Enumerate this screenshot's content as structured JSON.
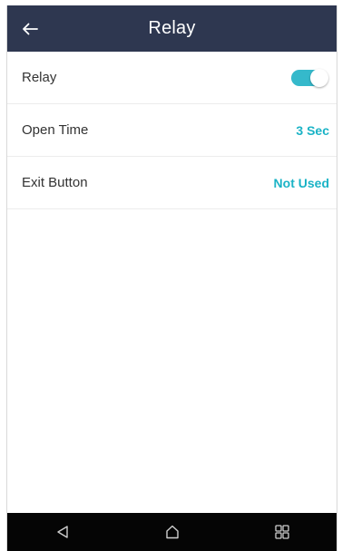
{
  "app_bar": {
    "title": "Relay",
    "background": "#2e3750",
    "back_icon": "arrow-left-icon"
  },
  "settings": [
    {
      "label": "Relay",
      "type": "toggle",
      "enabled": true
    },
    {
      "label": "Open Time",
      "type": "value",
      "value": "3 Sec"
    },
    {
      "label": "Exit Button",
      "type": "value",
      "value": "Not Used"
    }
  ],
  "accent_color": "#1ab3c6",
  "nav_bar": {
    "icons": [
      "triangle-back-icon",
      "home-icon",
      "recent-apps-icon"
    ]
  }
}
